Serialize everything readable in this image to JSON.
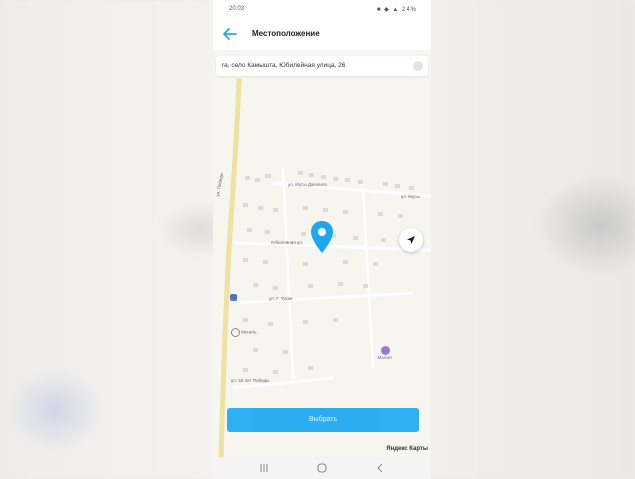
{
  "status_bar": {
    "time": "20:03",
    "icons": "■ ◆ ▲ 24%"
  },
  "app_bar": {
    "title": "Местоположение"
  },
  "address_bar": {
    "value": "ra, село Камышта, Юбилейная улица, 26"
  },
  "map": {
    "street_labels": [
      "ул. Мусы Джалиля",
      "ул. Мусы",
      "ул. Победы",
      "Юбилейная ул.",
      "ул. Г. Тукая",
      "ул. 50 лет Победы"
    ],
    "poi_labels": [
      "Мечеть",
      "Магнит"
    ]
  },
  "select_button": {
    "label": "Выбрать"
  },
  "attribution": {
    "text": "Яндекс Карты"
  },
  "colors": {
    "accent": "#23aaf2",
    "pin": "#1ea7ef",
    "road": "#f0e3a5"
  }
}
